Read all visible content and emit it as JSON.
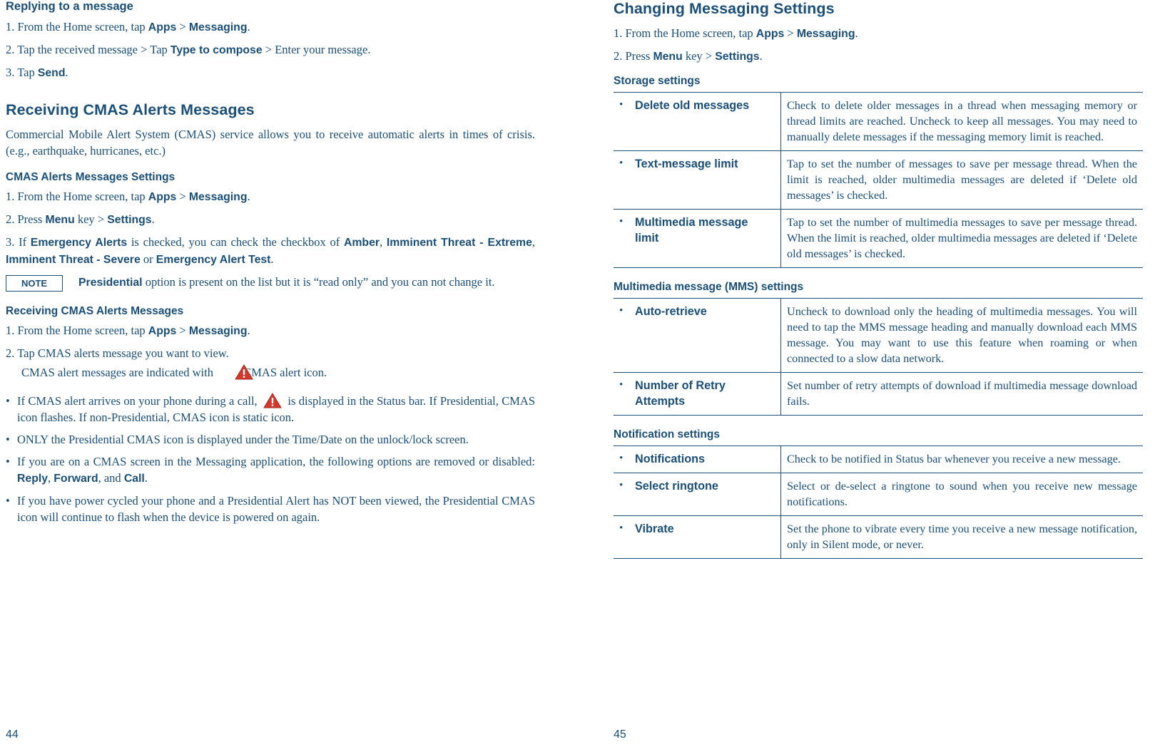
{
  "left": {
    "heading_replying": "Replying to a message",
    "steps_replying": [
      {
        "num": "1.",
        "parts": [
          {
            "t": "From the Home screen, tap ",
            "b": false
          },
          {
            "t": "Apps",
            "b": true
          },
          {
            "t": " > ",
            "b": false
          },
          {
            "t": "Messaging",
            "b": true
          },
          {
            "t": ".",
            "b": false
          }
        ]
      },
      {
        "num": "2.",
        "parts": [
          {
            "t": "Tap the received message > Tap ",
            "b": false
          },
          {
            "t": "Type to compose",
            "b": true
          },
          {
            "t": " > Enter your message.",
            "b": false
          }
        ]
      },
      {
        "num": "3.",
        "parts": [
          {
            "t": "Tap ",
            "b": false
          },
          {
            "t": "Send",
            "b": true
          },
          {
            "t": ".",
            "b": false
          }
        ]
      }
    ],
    "heading_cmas": "Receiving CMAS Alerts Messages",
    "cmas_intro": "Commercial Mobile Alert System (CMAS) service allows you to receive automatic alerts in times of crisis. (e.g., earthquake, hurricanes, etc.)",
    "subheading_cmas_settings": "CMAS Alerts Messages Settings",
    "steps_cmas_settings": [
      {
        "num": "1.",
        "parts": [
          {
            "t": "From the Home screen, tap ",
            "b": false
          },
          {
            "t": "Apps",
            "b": true
          },
          {
            "t": " > ",
            "b": false
          },
          {
            "t": "Messaging",
            "b": true
          },
          {
            "t": ".",
            "b": false
          }
        ]
      },
      {
        "num": "2.",
        "parts": [
          {
            "t": "Press ",
            "b": false
          },
          {
            "t": "Menu",
            "b": true
          },
          {
            "t": " key > ",
            "b": false
          },
          {
            "t": "Settings",
            "b": true
          },
          {
            "t": ".",
            "b": false
          }
        ]
      },
      {
        "num": "3.",
        "parts": [
          {
            "t": "If ",
            "b": false
          },
          {
            "t": "Emergency Alerts",
            "b": true
          },
          {
            "t": " is checked, you can check the checkbox of ",
            "b": false
          },
          {
            "t": "Amber",
            "b": true
          },
          {
            "t": ", ",
            "b": false
          },
          {
            "t": "Imminent Threat - Extreme",
            "b": true
          },
          {
            "t": ", ",
            "b": false
          },
          {
            "t": "Imminent Threat - Severe",
            "b": true
          },
          {
            "t": " or ",
            "b": false
          },
          {
            "t": "Emergency Alert Test",
            "b": true
          },
          {
            "t": ".",
            "b": false
          }
        ]
      }
    ],
    "note_label": "NOTE",
    "note_parts": [
      {
        "t": "Presidential",
        "b": true
      },
      {
        "t": " option is present on the list but it is “read only” and you can not change it.",
        "b": false
      }
    ],
    "subheading_receiving": "Receiving CMAS Alerts Messages",
    "steps_receiving": [
      {
        "num": "1.",
        "parts": [
          {
            "t": "From the Home screen, tap ",
            "b": false
          },
          {
            "t": "Apps",
            "b": true
          },
          {
            "t": " > ",
            "b": false
          },
          {
            "t": "Messaging",
            "b": true
          },
          {
            "t": ".",
            "b": false
          }
        ]
      }
    ],
    "step2_line1": "2. Tap CMAS alerts message you want to view.",
    "step2_line2_pre": "CMAS alert messages are indicated with",
    "step2_line2_post": "CMAS alert icon.",
    "bullets": [
      {
        "parts": [
          {
            "t": "If CMAS alert arrives on your phone during a call, ",
            "b": false
          },
          {
            "t": "[ICON]",
            "b": false,
            "icon": true
          },
          {
            "t": " is displayed in the Status bar. If Presidential, CMAS icon flashes. If non-Presidential, CMAS icon is static icon.",
            "b": false
          }
        ]
      },
      {
        "parts": [
          {
            "t": "ONLY the Presidential CMAS icon is displayed under the Time/Date on the unlock/lock screen.",
            "b": false
          }
        ]
      },
      {
        "parts": [
          {
            "t": "If you are on a CMAS screen in the Messaging application, the following options are removed or disabled: ",
            "b": false
          },
          {
            "t": "Reply",
            "b": true
          },
          {
            "t": ", ",
            "b": false
          },
          {
            "t": "Forward",
            "b": true
          },
          {
            "t": ", and ",
            "b": false
          },
          {
            "t": "Call",
            "b": true
          },
          {
            "t": ".",
            "b": false
          }
        ]
      },
      {
        "parts": [
          {
            "t": "If you have power cycled your phone and a Presidential Alert has NOT been viewed, the Presidential CMAS icon will continue to flash when the device is powered on again.",
            "b": false
          }
        ]
      }
    ],
    "page_number": "44"
  },
  "right": {
    "heading": "Changing Messaging Settings",
    "steps": [
      {
        "num": "1.",
        "parts": [
          {
            "t": "From the Home screen, tap ",
            "b": false
          },
          {
            "t": "Apps",
            "b": true
          },
          {
            "t": " > ",
            "b": false
          },
          {
            "t": "Messaging",
            "b": true
          },
          {
            "t": ".",
            "b": false
          }
        ]
      },
      {
        "num": "2.",
        "parts": [
          {
            "t": "Press ",
            "b": false
          },
          {
            "t": "Menu",
            "b": true
          },
          {
            "t": " key > ",
            "b": false
          },
          {
            "t": "Settings",
            "b": true
          },
          {
            "t": ".",
            "b": false
          }
        ]
      }
    ],
    "storage_heading": "Storage settings",
    "storage_rows": [
      {
        "label": "Delete old messages",
        "desc": "Check to delete older messages in a thread when messaging memory or thread limits are reached. Uncheck to keep all messages. You may need to manually delete messages if the messaging memory limit is reached."
      },
      {
        "label": "Text-message limit",
        "desc": "Tap to set the number of messages to save per message thread. When the limit is reached, older multimedia messages are deleted if ‘Delete old messages’ is checked."
      },
      {
        "label": "Multimedia message limit",
        "desc": "Tap to set the number of multimedia messages to save per message thread. When the limit is reached, older multimedia messages are deleted if ‘Delete old messages’ is checked."
      }
    ],
    "mms_heading": "Multimedia message (MMS) settings",
    "mms_rows": [
      {
        "label": "Auto-retrieve",
        "desc": "Uncheck to download only the heading of multimedia messages. You will need to tap the MMS message heading and manually download each MMS message. You may want to use this feature when roaming or when connected to a slow data network."
      },
      {
        "label": "Number of Retry Attempts",
        "desc": "Set number of retry attempts of download if multimedia message download fails."
      }
    ],
    "notif_heading": "Notification settings",
    "notif_rows": [
      {
        "label": "Notifications",
        "desc": "Check to be notified in Status bar whenever you receive a new message."
      },
      {
        "label": "Select ringtone",
        "desc": "Select or de-select a ringtone to sound when you receive new message notifications."
      },
      {
        "label": "Vibrate",
        "desc": "Set the phone to vibrate every time you receive a new message notification, only in Silent mode, or never."
      }
    ],
    "page_number": "45"
  },
  "colors": {
    "text": "#1a4f7a",
    "warning_icon": "#d4372c"
  }
}
